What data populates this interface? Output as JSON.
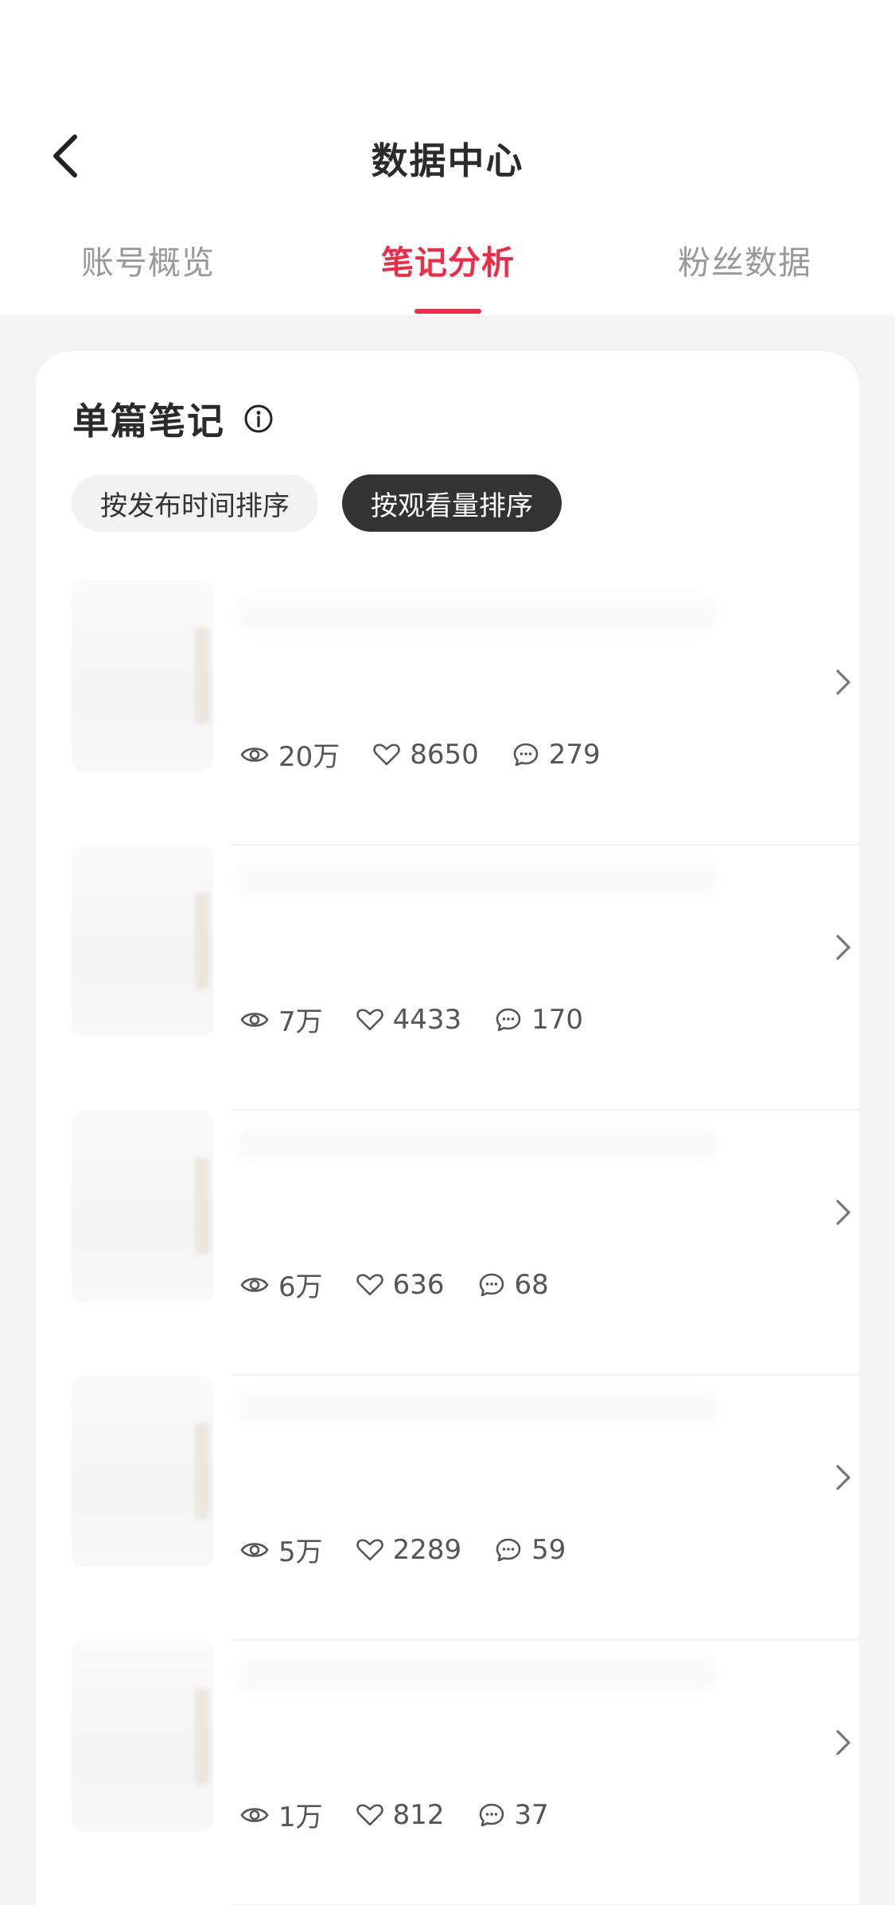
{
  "header": {
    "title": "数据中心",
    "back_icon": "chevron-left-icon"
  },
  "tabs": [
    {
      "label": "账号概览",
      "active": false
    },
    {
      "label": "笔记分析",
      "active": true
    },
    {
      "label": "粉丝数据",
      "active": false
    }
  ],
  "section": {
    "title": "单篇笔记",
    "info_icon": "info-icon"
  },
  "sort": {
    "by_time": "按发布时间排序",
    "by_views": "按观看量排序",
    "selected": "by_views"
  },
  "notes": [
    {
      "views": "20万",
      "likes": "8650",
      "comments": "279"
    },
    {
      "views": "7万",
      "likes": "4433",
      "comments": "170"
    },
    {
      "views": "6万",
      "likes": "636",
      "comments": "68"
    },
    {
      "views": "5万",
      "likes": "2289",
      "comments": "59"
    },
    {
      "views": "1万",
      "likes": "812",
      "comments": "37"
    }
  ],
  "colors": {
    "accent": "#ef2b47",
    "chip_selected": "#333333",
    "chip_unselected": "#f2f2f2",
    "page_bg": "#f3f3f3"
  }
}
